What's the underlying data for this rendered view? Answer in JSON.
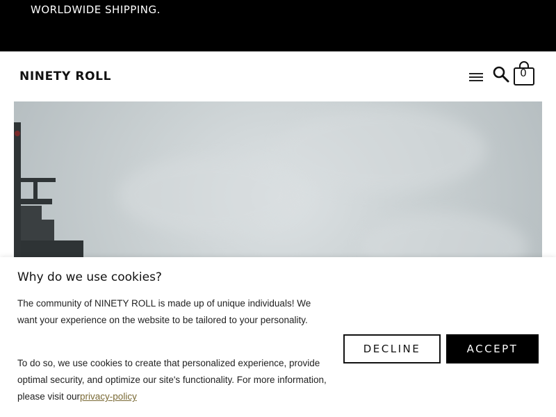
{
  "announcement": {
    "text": "WORLDWIDE SHIPPING."
  },
  "header": {
    "logo": "NINETY ROLL",
    "menu_icon": "hamburger-menu-icon",
    "search_icon": "search-icon",
    "cart_icon": "shopping-bag-icon",
    "cart_count": "0"
  },
  "hero": {
    "image": "foggy harbour crane photo"
  },
  "cookie_banner": {
    "title": "Why do we use cookies?",
    "paragraph1": "The community of NINETY ROLL is made up of unique individuals! We want your experience on the website to be tailored to your personality.",
    "paragraph2": "To do so, we use cookies to create that personalized experience, provide optimal security, and optimize our site's functionality. For more information, please visit our",
    "privacy_link": "privacy-policy",
    "decline_label": "DECLINE",
    "accept_label": "ACCEPT"
  },
  "colors": {
    "announcement_bg": "#000000",
    "accent_link": "#7a6a35",
    "accept_bg": "#000000"
  }
}
